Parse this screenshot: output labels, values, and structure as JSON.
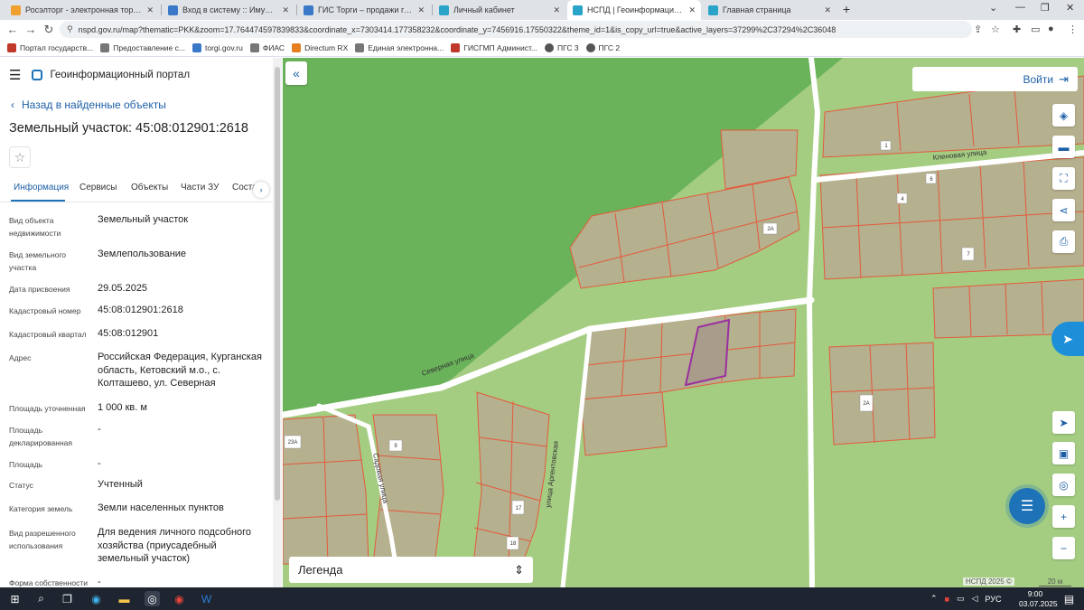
{
  "browser": {
    "tabs": [
      {
        "label": "Росэлторг - электронная торгов",
        "color": "#f0a030"
      },
      {
        "label": "Вход в систему :: Имущественн",
        "color": "#3a78c8"
      },
      {
        "label": "ГИС Торги – продажи государс",
        "color": "#3a78c8"
      },
      {
        "label": "Личный кабинет",
        "color": "#2aa3c8"
      },
      {
        "label": "НСПД | Геоинформационный п",
        "color": "#2aa3c8"
      },
      {
        "label": "Главная страница",
        "color": "#2aa3c8"
      }
    ],
    "url": "nspd.gov.ru/map?thematic=PKK&zoom=17.764474597839833&coordinate_x=7303414.177358232&coordinate_y=7456916.17550322&theme_id=1&is_copy_url=true&active_layers=37299%2C37294%2C36048",
    "bookmarks": [
      {
        "label": "Портал государств...",
        "color": "#c0392b"
      },
      {
        "label": "Предоставление с...",
        "color": "#777"
      },
      {
        "label": "torgi.gov.ru",
        "color": "#3a78c8"
      },
      {
        "label": "ФИАС",
        "color": "#777"
      },
      {
        "label": "Directum RX",
        "color": "#e67e22"
      },
      {
        "label": "Единая электронна...",
        "color": "#777"
      },
      {
        "label": "ГИСГМП Админист...",
        "color": "#c0392b"
      },
      {
        "label": "ПГС 3",
        "color": "#555"
      },
      {
        "label": "ПГС 2",
        "color": "#555"
      }
    ]
  },
  "panel": {
    "portal_title": "Геоинформационный портал",
    "back_label": "Назад в найденные объекты",
    "object_title": "Земельный участок: 45:08:012901:2618",
    "tabs": [
      "Информация",
      "Сервисы",
      "Объекты",
      "Части ЗУ",
      "Соста"
    ],
    "properties": [
      {
        "label": "Вид объекта недвижимости",
        "value": "Земельный участок"
      },
      {
        "label": "Вид земельного участка",
        "value": "Землепользование"
      },
      {
        "label": "Дата присвоения",
        "value": "29.05.2025"
      },
      {
        "label": "Кадастровый номер",
        "value": "45:08:012901:2618"
      },
      {
        "label": "Кадастровый квартал",
        "value": "45:08:012901"
      },
      {
        "label": "Адрес",
        "value": "Российская Федерация, Курганская область, Кетовский м.о., с. Колташево, ул. Северная"
      },
      {
        "label": "Площадь уточненная",
        "value": "1 000 кв. м"
      },
      {
        "label": "Площадь декларированная",
        "value": "-"
      },
      {
        "label": "Площадь",
        "value": "-"
      },
      {
        "label": "Статус",
        "value": "Учтенный"
      },
      {
        "label": "Категория земель",
        "value": "Земли населенных пунктов"
      },
      {
        "label": "Вид разрешенного использования",
        "value": "Для ведения личного подсобного хозяйства (приусадебный земельный участок)"
      },
      {
        "label": "Форма собственности",
        "value": "-"
      }
    ]
  },
  "map": {
    "login_label": "Войти",
    "legend_label": "Легенда",
    "attribution": "НСПД 2025 ©",
    "scale_label": "20 м",
    "streets": [
      "Кленовая улица",
      "Северная улица",
      "Садовая улица",
      "улица Аргентовская"
    ],
    "plot_labels": [
      "1",
      "4",
      "6",
      "2А",
      "7",
      "2А",
      "9",
      "17",
      "18",
      "23А"
    ],
    "colors": {
      "forest": "#6ab35a",
      "field": "#a4cd82",
      "parcel": "#b5b08e",
      "border": "#e45a3c",
      "selected": "#9a2fa0",
      "road": "#ffffff"
    }
  },
  "taskbar": {
    "lang": "РУС",
    "time": "9:00",
    "date": "03.07.2025"
  }
}
